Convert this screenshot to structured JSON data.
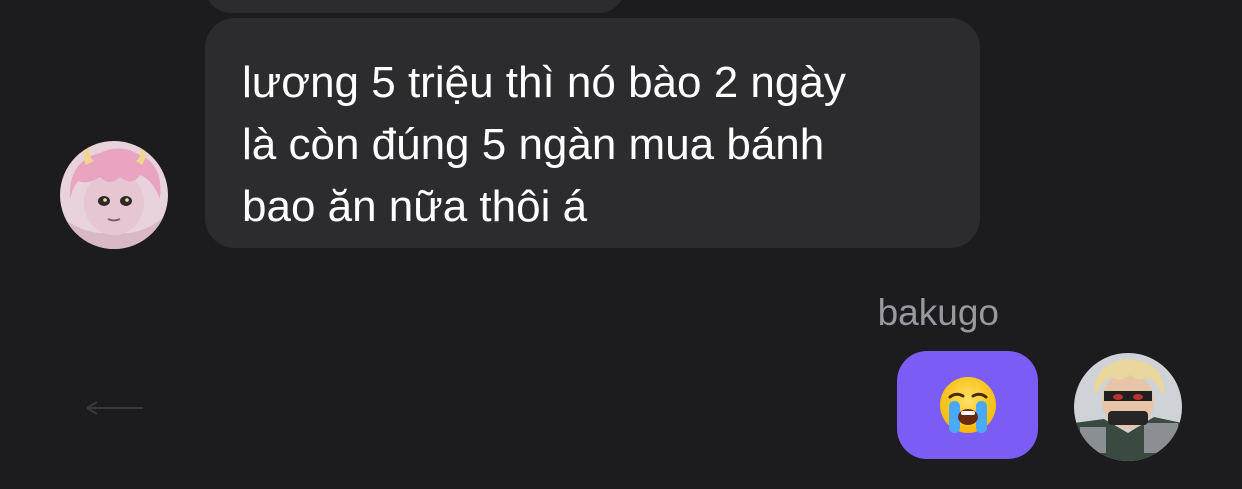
{
  "chat": {
    "incoming": {
      "text": "lương 5 triệu thì nó bào 2 ngày\nlà còn đúng 5 ngàn mua bánh\nbao ăn nữa thôi á",
      "avatar_icon": "avatar-pink-hair-character"
    },
    "outgoing": {
      "sender": "bakugo",
      "emoji": "😭",
      "emoji_name": "loudly-crying-face-emoji",
      "avatar_icon": "avatar-blond-hero-character"
    }
  },
  "colors": {
    "background": "#1c1c1e",
    "incoming_bubble": "#2c2c2e",
    "outgoing_bubble": "#7b5cf5",
    "text": "#ffffff",
    "sender_label": "#98989f"
  }
}
